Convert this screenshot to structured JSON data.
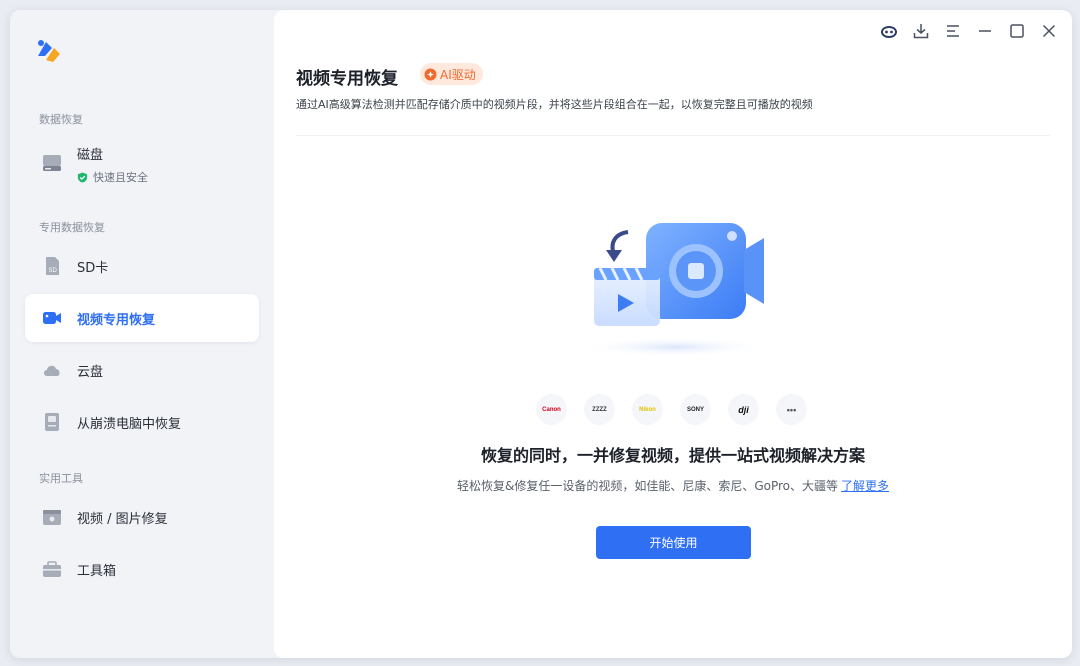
{
  "sidebar": {
    "sections": [
      {
        "title": "数据恢复"
      },
      {
        "title": "专用数据恢复"
      },
      {
        "title": "实用工具"
      }
    ],
    "disk": {
      "label": "磁盘",
      "sub": "快速且安全"
    },
    "items": [
      {
        "label": "SD卡"
      },
      {
        "label": "视频专用恢复"
      },
      {
        "label": "云盘"
      },
      {
        "label": "从崩溃电脑中恢复"
      },
      {
        "label": "视频 / 图片修复"
      },
      {
        "label": "工具箱"
      }
    ]
  },
  "main": {
    "title": "视频专用恢复",
    "ai_badge": "AI驱动",
    "description": "通过AI高级算法检测并匹配存储介质中的视频片段，并将这些片段组合在一起，以恢复完整且可播放的视频",
    "brands": [
      "Canon",
      "ZZZZ",
      "Nikon",
      "SONY",
      "dji",
      "•••"
    ],
    "headline": "恢复的同时，一并修复视频，提供一站式视频解决方案",
    "subline": "轻松恢复&修复任一设备的视频，如佳能、尼康、索尼、GoPro、大疆等",
    "learn_more": "了解更多",
    "start_button": "开始使用"
  },
  "colors": {
    "accent": "#2e6ff3",
    "ai_badge_bg": "#ffe8dc",
    "ai_badge_text": "#f26a2e",
    "safe_green": "#1fb86b"
  }
}
